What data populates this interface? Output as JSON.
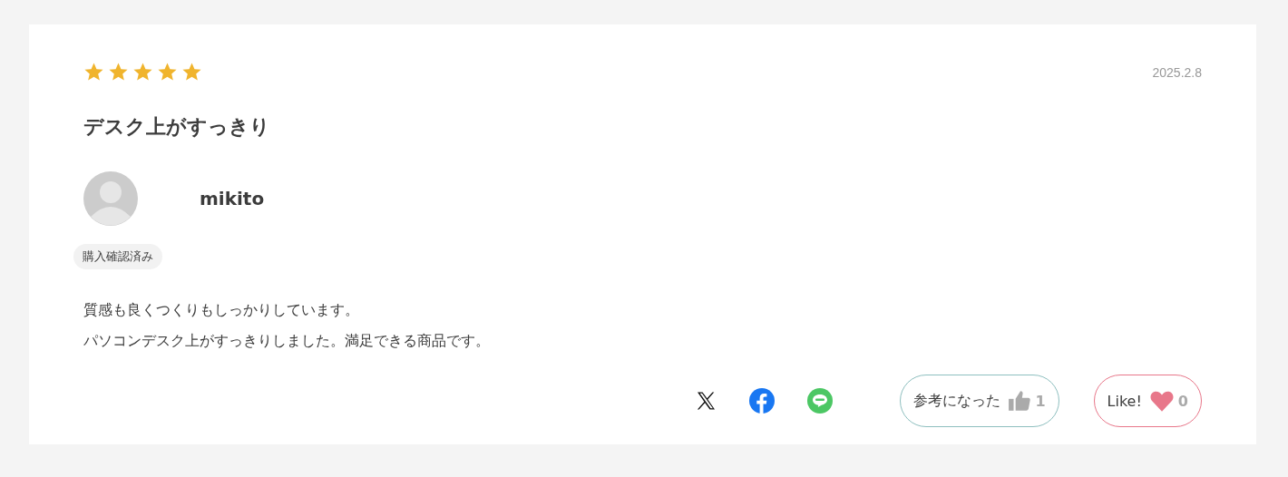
{
  "review": {
    "stars": 5,
    "date": "2025.2.8",
    "title": "デスク上がすっきり",
    "reviewer": {
      "name": "mikito",
      "badge": "購入確認済み"
    },
    "body": [
      "質感も良くつくりもしっかりしています。",
      "パソコンデスク上がすっきりしました。満足できる商品です。"
    ],
    "share": [
      {
        "kind": "x"
      },
      {
        "kind": "facebook"
      },
      {
        "kind": "line"
      }
    ],
    "helpful": {
      "label": "参考になった",
      "count": "1"
    },
    "like": {
      "label": "Like!",
      "count": "0"
    }
  }
}
